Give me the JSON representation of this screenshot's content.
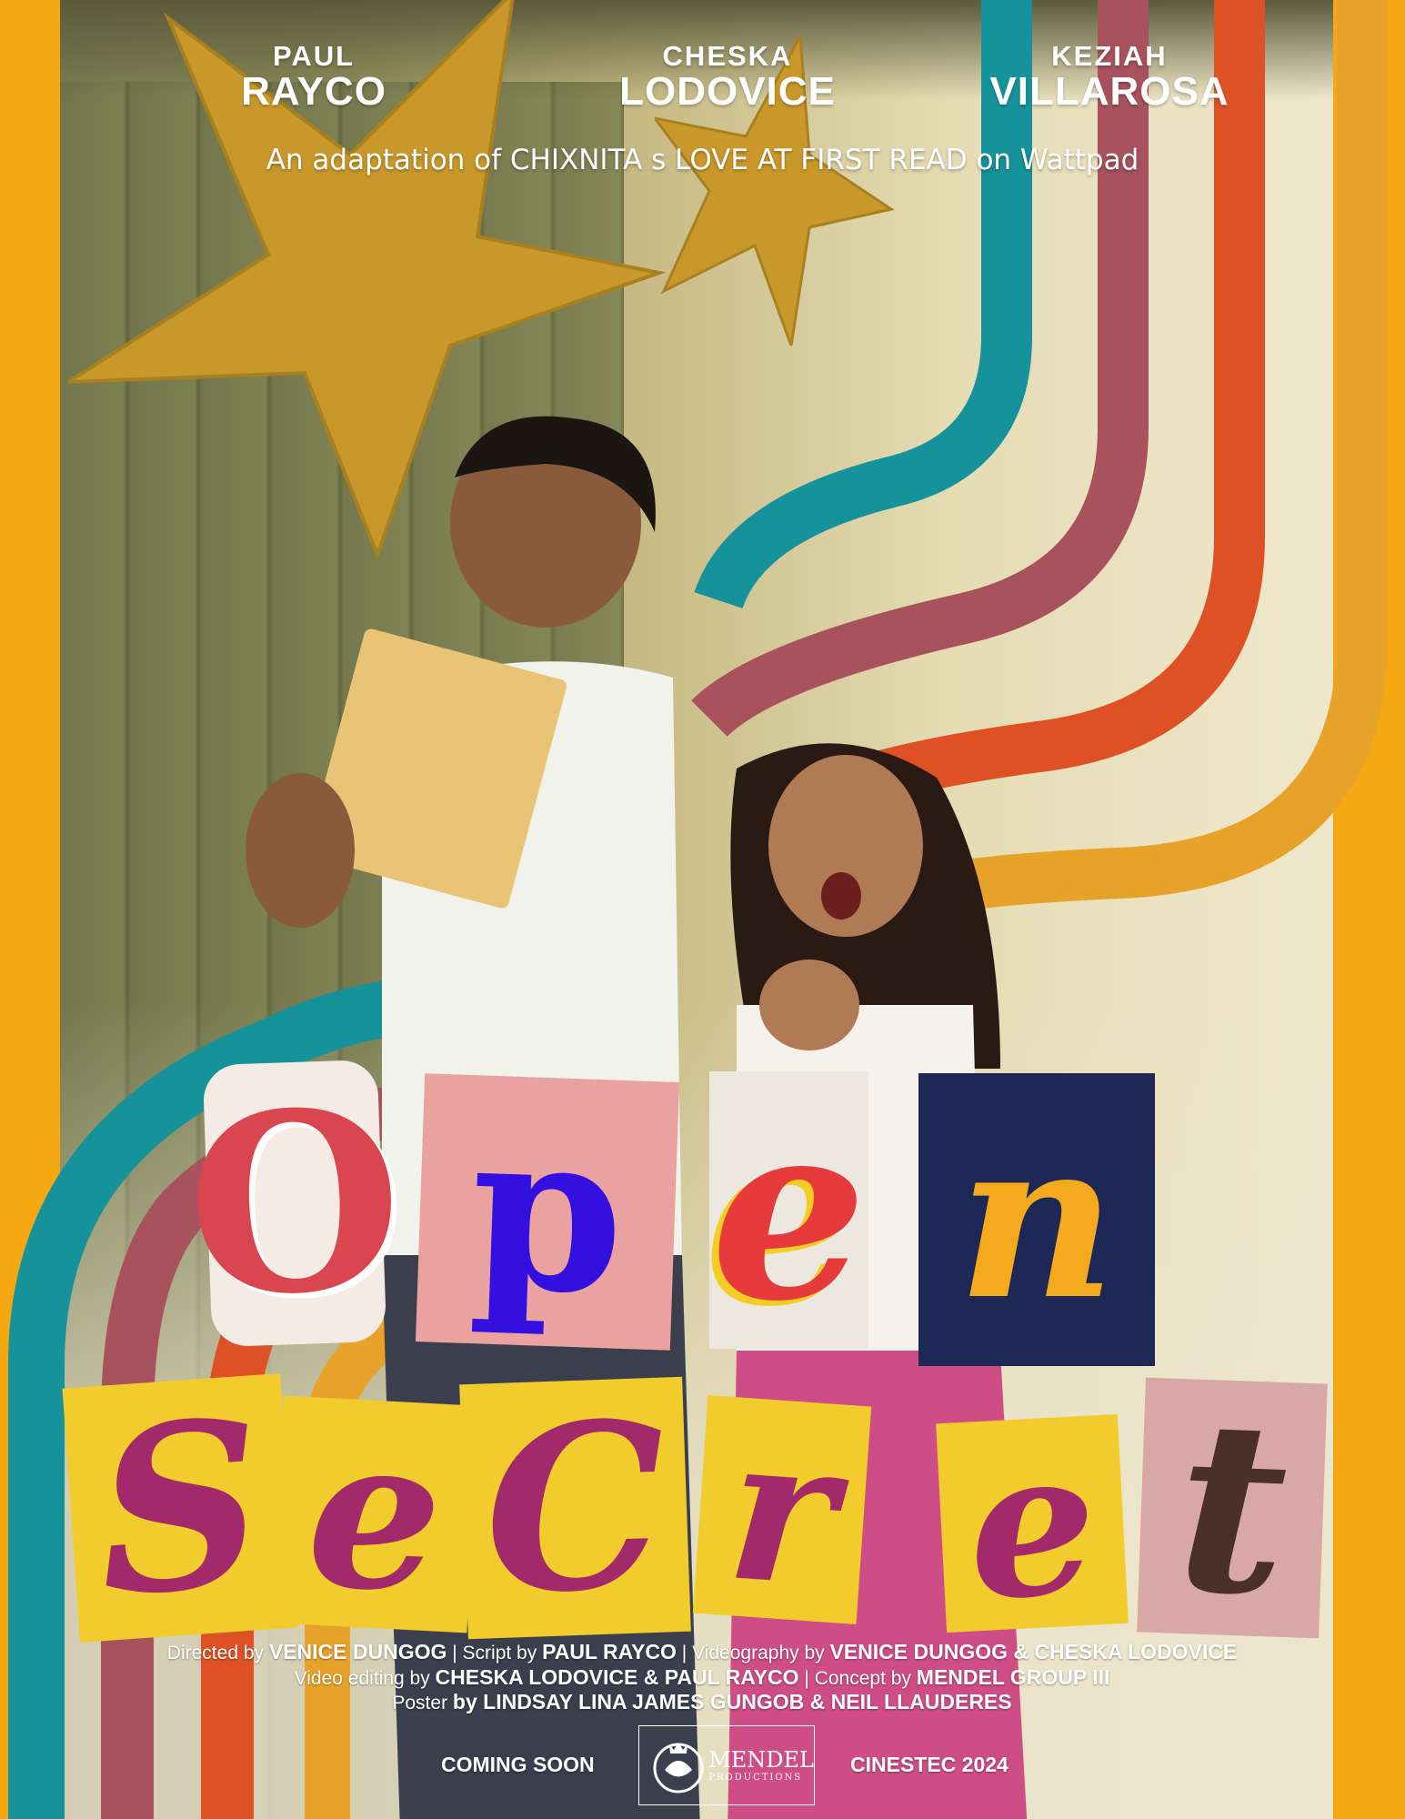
{
  "cast": [
    {
      "first": "PAUL",
      "last": "RAYCO"
    },
    {
      "first": "CHESKA",
      "last": "LODOVICE"
    },
    {
      "first": "KEZIAH",
      "last": "VILLAROSA"
    }
  ],
  "adaptation": "An adaptation of CHIXNITA  s LOVE AT FIRST READ on Wattpad",
  "title": {
    "line1": [
      "O",
      "p",
      "e",
      "n"
    ],
    "line2": [
      "S",
      "e",
      "C",
      "r",
      "e",
      "t"
    ]
  },
  "credits": {
    "line1": [
      {
        "role": "Directed by",
        "name": "VENICE DUNGOG"
      },
      {
        "role": "Script by",
        "name": "PAUL RAYCO"
      },
      {
        "role": "Videography by",
        "name": "VENICE DUNGOG & CHESKA LODOVICE"
      }
    ],
    "line2": [
      {
        "role": "Video editing by",
        "name": "CHESKA LODOVICE & PAUL RAYCO"
      },
      {
        "role": "Concept by",
        "name": "MENDEL GROUP III"
      }
    ],
    "line3": [
      {
        "role": "Poster",
        "name": "by LINDSAY LINA JAMES GUNGOB & NEIL LLAUDERES"
      }
    ],
    "separator": "|"
  },
  "footer": {
    "left": "COMING SOON",
    "right": "CINESTEC 2024",
    "logo_name": "MENDEL",
    "logo_sub": "PRODUCTIONS"
  },
  "colors": {
    "border": "#f5a812",
    "teal": "#16939a",
    "mauve": "#a8525d",
    "orange": "#dd5125",
    "gold": "#e7a229",
    "star": "#c9982b",
    "title_magenta": "#a32a6a",
    "title_yellow": "#f2cc2c"
  },
  "icons": [
    "star-icon",
    "mendel-logo-icon"
  ]
}
